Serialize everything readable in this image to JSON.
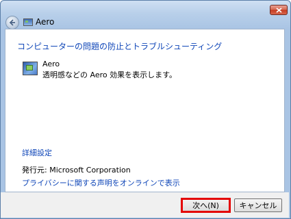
{
  "window": {
    "title": "Aero"
  },
  "heading": "コンピューターの問題の防止とトラブルシューティング",
  "feature": {
    "name": "Aero",
    "description": "透明感などの Aero 効果を表示します。"
  },
  "links": {
    "advanced": "詳細設定",
    "privacy": "プライバシーに関する声明をオンラインで表示"
  },
  "publisher": "発行元:  Microsoft Corporation",
  "buttons": {
    "next": "次へ(N)",
    "cancel": "キャンセル"
  }
}
